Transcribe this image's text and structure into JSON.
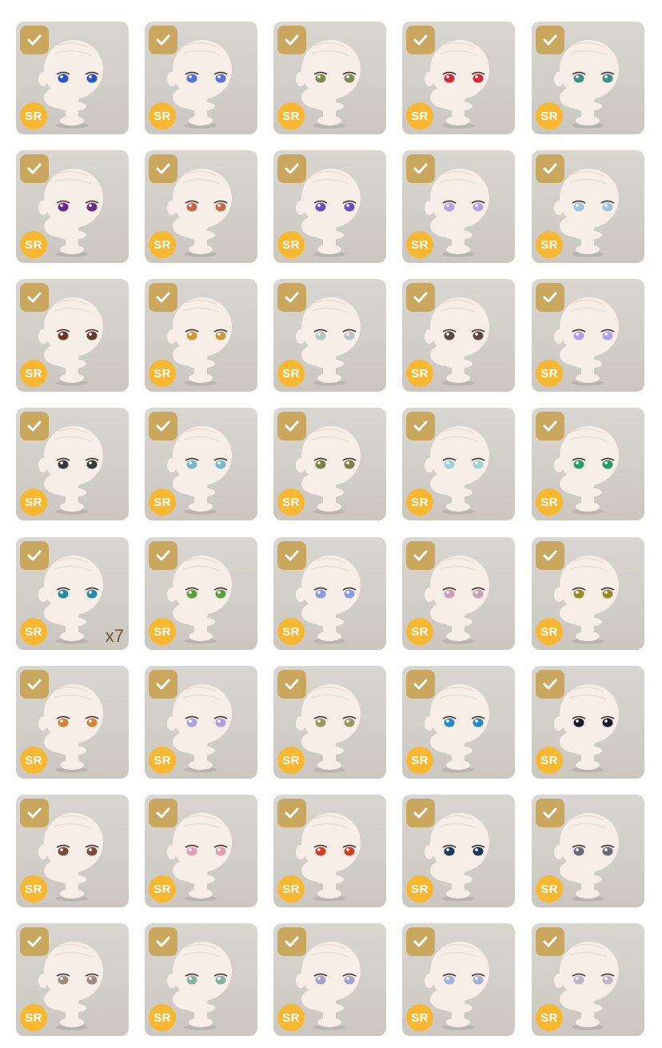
{
  "rarity_label": "SR",
  "colors": {
    "tile_bg": "#cfccc6",
    "check_badge": "#c9a75f",
    "rarity_badge": "#f7b731",
    "head": "#f6eee7"
  },
  "icons": {
    "check": "checkmark-icon",
    "rarity": "sr-rarity-badge"
  },
  "items": [
    {
      "eye": "#2b55c8",
      "owned": true,
      "count": ""
    },
    {
      "eye": "#5b6fd8",
      "owned": true,
      "count": ""
    },
    {
      "eye": "#7f8a52",
      "owned": true,
      "count": ""
    },
    {
      "eye": "#d42a3a",
      "owned": true,
      "count": ""
    },
    {
      "eye": "#3f8f86",
      "owned": true,
      "count": ""
    },
    {
      "eye": "#6a2b8a",
      "owned": true,
      "count": ""
    },
    {
      "eye": "#c46a4c",
      "owned": true,
      "count": ""
    },
    {
      "eye": "#6a4fc0",
      "owned": true,
      "count": ""
    },
    {
      "eye": "#b7a2e0",
      "owned": true,
      "count": ""
    },
    {
      "eye": "#9fc4e0",
      "owned": true,
      "count": ""
    },
    {
      "eye": "#6a3a2a",
      "owned": true,
      "count": ""
    },
    {
      "eye": "#c99a3a",
      "owned": true,
      "count": ""
    },
    {
      "eye": "#b9c4c4",
      "owned": true,
      "count": ""
    },
    {
      "eye": "#5a4a42",
      "owned": true,
      "count": ""
    },
    {
      "eye": "#b2a0e4",
      "owned": true,
      "count": ""
    },
    {
      "eye": "#3a3a3a",
      "owned": true,
      "count": ""
    },
    {
      "eye": "#7ab7c4",
      "owned": true,
      "count": ""
    },
    {
      "eye": "#7a8048",
      "owned": true,
      "count": ""
    },
    {
      "eye": "#9fd4d4",
      "owned": true,
      "count": ""
    },
    {
      "eye": "#2a9a6a",
      "owned": true,
      "count": ""
    },
    {
      "eye": "#2a8aa0",
      "owned": true,
      "count": "x7"
    },
    {
      "eye": "#5aa040",
      "owned": true,
      "count": ""
    },
    {
      "eye": "#8a9ae0",
      "owned": true,
      "count": ""
    },
    {
      "eye": "#c9a0b4",
      "owned": true,
      "count": ""
    },
    {
      "eye": "#9a8a2a",
      "owned": true,
      "count": ""
    },
    {
      "eye": "#d0843a",
      "owned": true,
      "count": ""
    },
    {
      "eye": "#b0a0d8",
      "owned": true,
      "count": ""
    },
    {
      "eye": "#9a9a60",
      "owned": true,
      "count": ""
    },
    {
      "eye": "#2a8ac8",
      "owned": true,
      "count": ""
    },
    {
      "eye": "#1a1a2a",
      "owned": true,
      "count": ""
    },
    {
      "eye": "#7a4a3a",
      "owned": true,
      "count": ""
    },
    {
      "eye": "#e0a0b4",
      "owned": true,
      "count": ""
    },
    {
      "eye": "#d04020",
      "owned": true,
      "count": ""
    },
    {
      "eye": "#1a3a5a",
      "owned": true,
      "count": ""
    },
    {
      "eye": "#6a6a74",
      "owned": true,
      "count": ""
    },
    {
      "eye": "#a08a84",
      "owned": true,
      "count": ""
    },
    {
      "eye": "#8ab0a0",
      "owned": true,
      "count": ""
    },
    {
      "eye": "#a0a0c8",
      "owned": true,
      "count": ""
    },
    {
      "eye": "#a0b0d8",
      "owned": true,
      "count": ""
    },
    {
      "eye": "#c0b4c8",
      "owned": true,
      "count": ""
    }
  ]
}
